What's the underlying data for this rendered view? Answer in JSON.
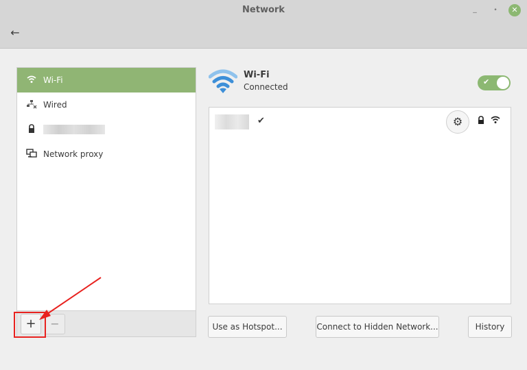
{
  "window": {
    "title": "Network",
    "min_glyph": "_",
    "max_glyph": "•",
    "close_glyph": "●"
  },
  "header": {
    "back_glyph": "←"
  },
  "sidebar": {
    "items": [
      {
        "label": "Wi-Fi",
        "icon": "wifi-icon",
        "glyph": "▽",
        "active": true
      },
      {
        "label": "Wired",
        "icon": "wired-icon",
        "glyph": "☷",
        "active": false
      },
      {
        "label": "",
        "icon": "vpn-lock-icon",
        "glyph": "🔒",
        "active": false,
        "redacted": true
      },
      {
        "label": "Network proxy",
        "icon": "proxy-icon",
        "glyph": "▣",
        "active": false
      }
    ],
    "add_label": "+",
    "remove_label": "−"
  },
  "wifi": {
    "title": "Wi-Fi",
    "status": "Connected",
    "enabled": true,
    "toggle_check": "✔"
  },
  "networks": [
    {
      "name": "",
      "redacted": true,
      "connected": true,
      "check_glyph": "✔",
      "gear_glyph": "⚙",
      "secured": true,
      "lock_glyph": "🔒"
    }
  ],
  "actions": {
    "hotspot": "Use as Hotspot...",
    "hidden": "Connect to Hidden Network...",
    "history": "History"
  },
  "annotation": {
    "color": "#e8221f"
  },
  "colors": {
    "accent": "#90b574",
    "toggle_on": "#8cb872"
  }
}
